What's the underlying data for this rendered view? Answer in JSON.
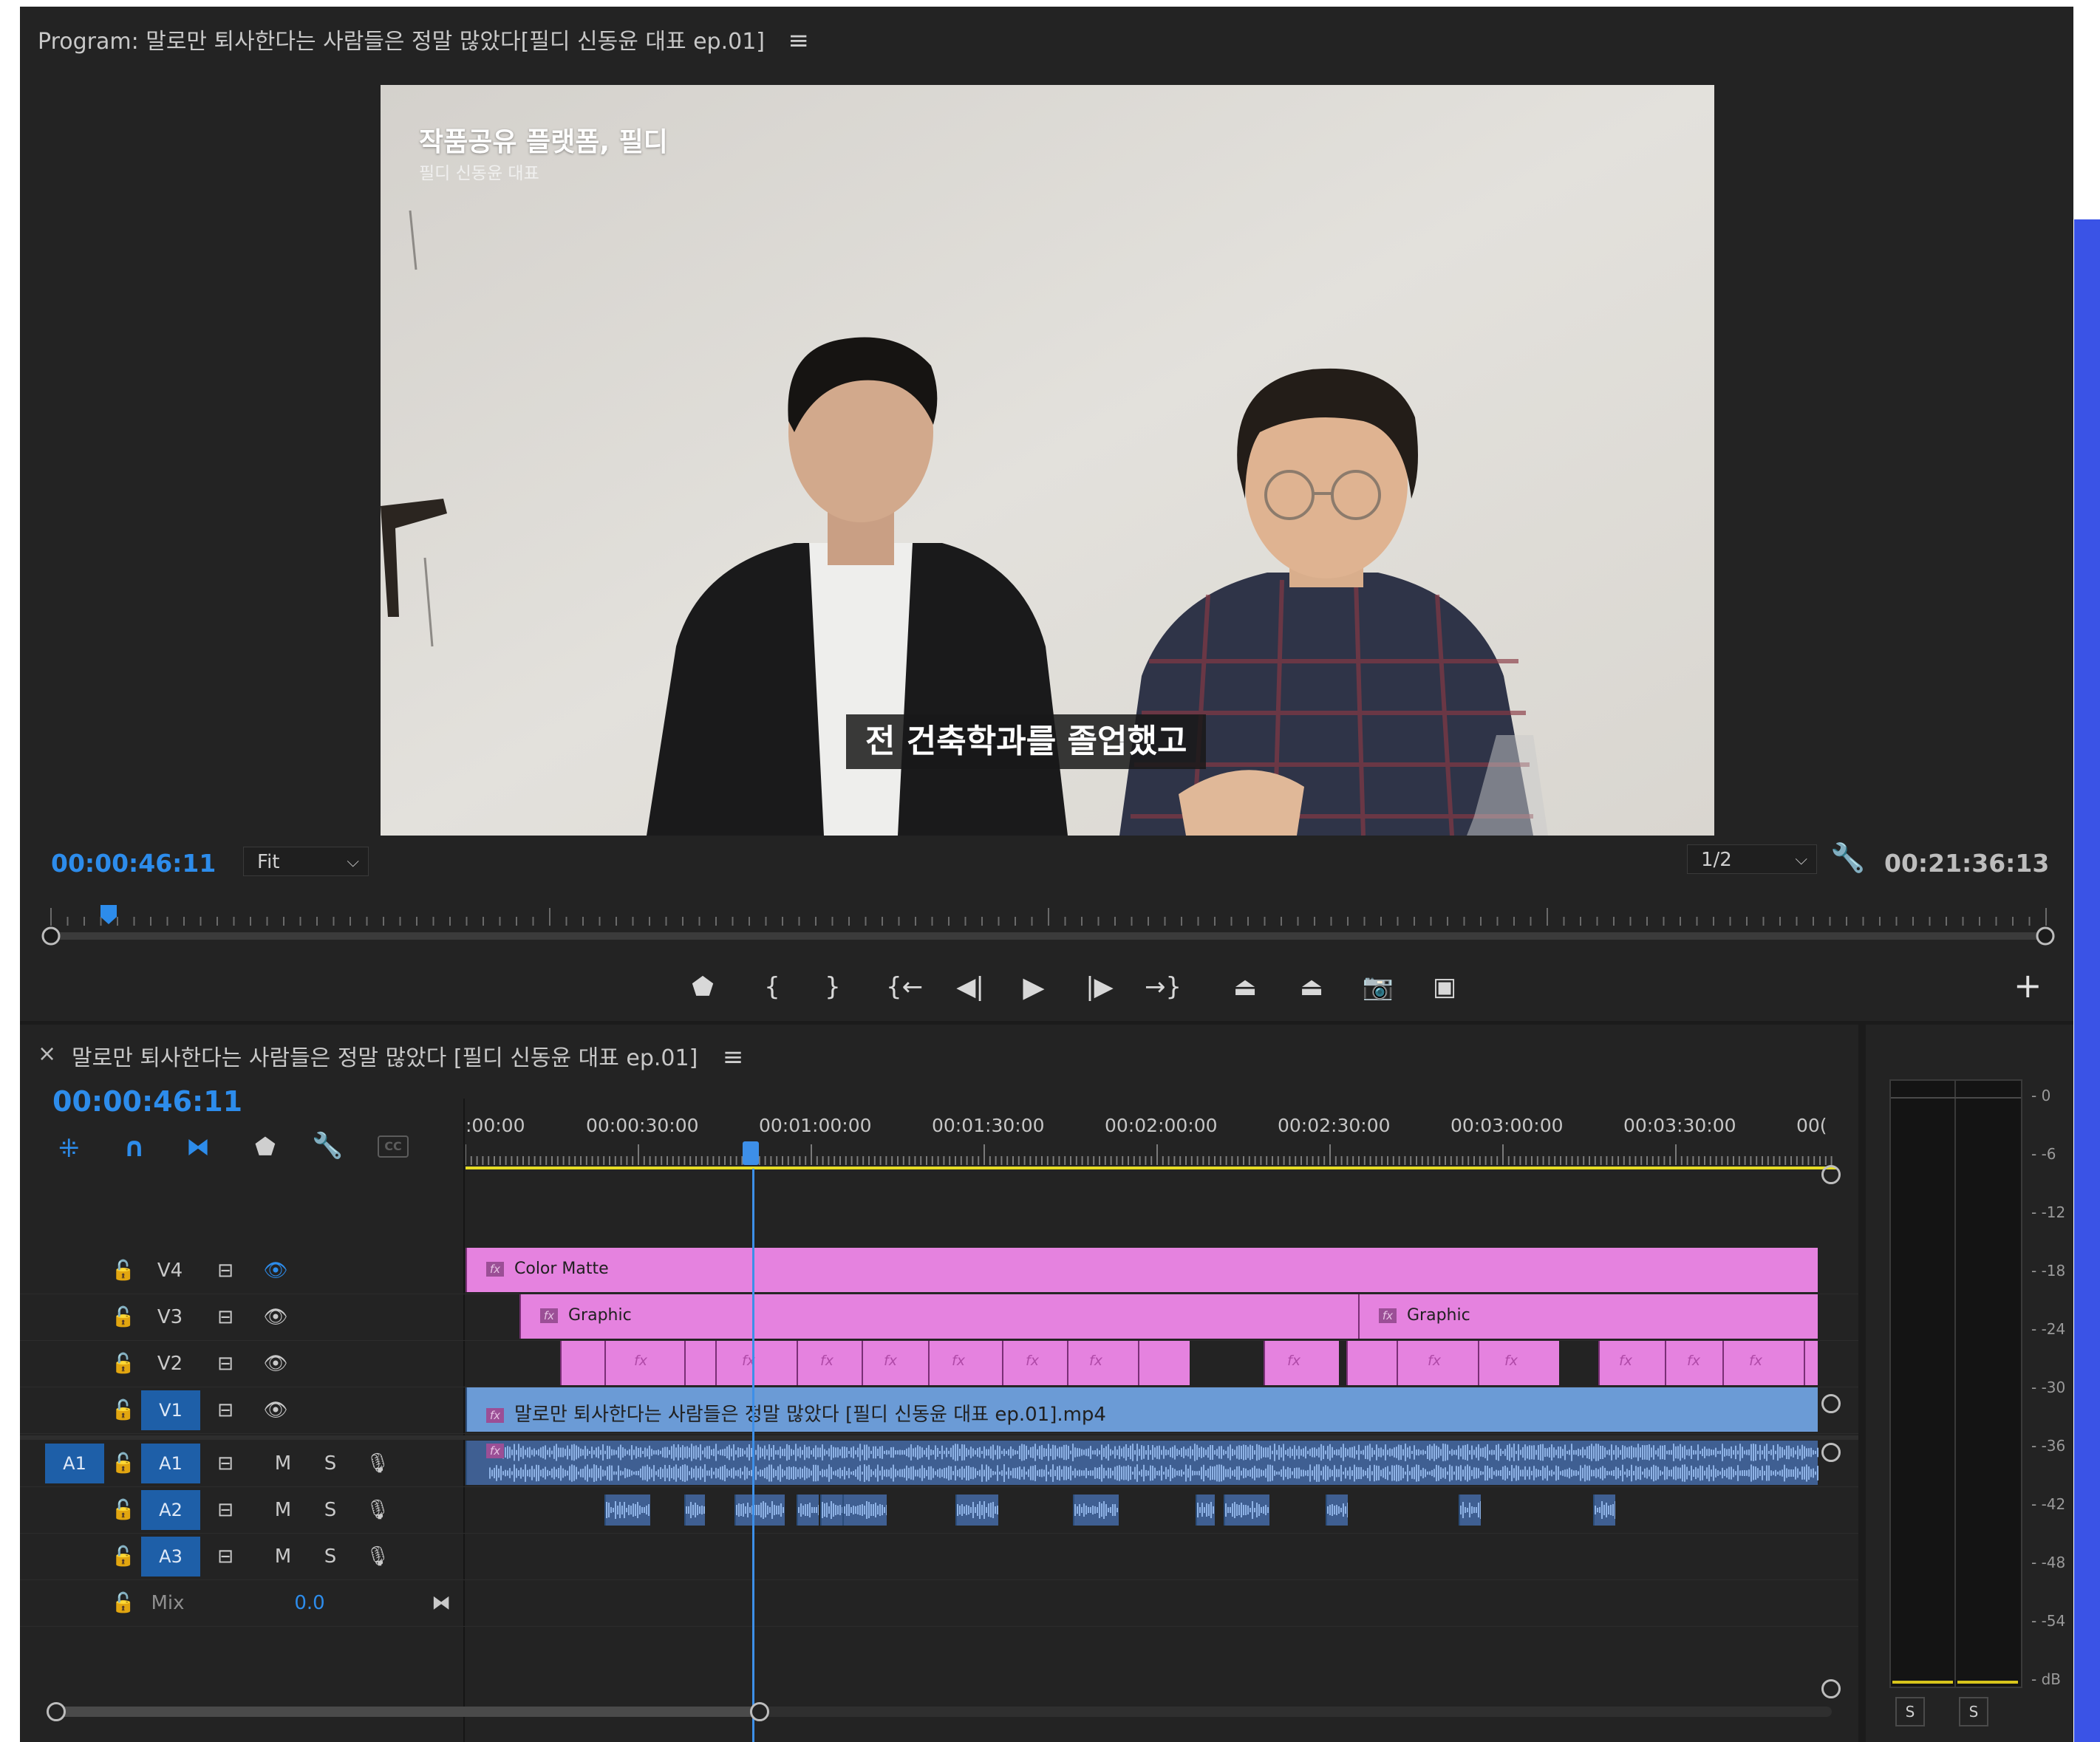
{
  "program": {
    "title": "Program: 말로만 퇴사한다는 사람들은 정말 많았다[필디 신동윤 대표 ep.01]",
    "menu_icon": "≡",
    "current_timecode": "00:00:46:11",
    "zoom_value": "Fit",
    "resolution_value": "1/2",
    "duration_timecode": "00:21:36:13",
    "video": {
      "overlay_title": "작품공유 플랫폼, 필디",
      "overlay_subtitle": "필디 신동윤 대표",
      "caption": "전 건축학과를 졸업했고"
    },
    "controls": [
      "marker-icon",
      "mark-in-icon",
      "mark-out-icon",
      "go-to-in-icon",
      "step-back-icon",
      "play-icon",
      "step-forward-icon",
      "go-to-out-icon",
      "lift-icon",
      "extract-icon",
      "export-frame-icon",
      "compare-view-icon"
    ],
    "add_button": "+"
  },
  "timeline": {
    "close": "×",
    "title": "말로만 퇴사한다는 사람들은 정말 많았다 [필디 신동윤 대표 ep.01]",
    "menu_icon": "≡",
    "current_timecode": "00:00:46:11",
    "ruler_labels": [
      ":00:00",
      "00:00:30:00",
      "00:01:00:00",
      "00:01:30:00",
      "00:02:00:00",
      "00:02:30:00",
      "00:03:00:00",
      "00:03:30:00",
      "00("
    ],
    "tracks": {
      "v4": "V4",
      "v3": "V3",
      "v2": "V2",
      "v1": "V1",
      "a1_source": "A1",
      "a1": "A1",
      "a2": "A2",
      "a3": "A3",
      "mute": "M",
      "solo": "S",
      "mix_label": "Mix",
      "mix_value": "0.0"
    },
    "clips": {
      "color_matte": "Color Matte",
      "graphic": "Graphic",
      "video_clip": "말로만 퇴사한다는 사람들은 정말 많았다 [필디 신동윤 대표 ep.01].mp4",
      "fx": "fx"
    },
    "playhead_time": "00:00:46:11",
    "playhead_fraction": 0.198
  },
  "audio_meter": {
    "scale": [
      "0",
      "-6",
      "-12",
      "-18",
      "-24",
      "-30",
      "-36",
      "-42",
      "-48",
      "-54",
      "dB"
    ],
    "solo_left": "S",
    "solo_right": "S"
  },
  "colors": {
    "timecode_blue": "#2d8ceb",
    "clip_pink": "#e582df",
    "clip_blue": "#6b9bd6",
    "playhead_blue": "#3d8fe8",
    "work_area_yellow": "#e5dc25"
  }
}
